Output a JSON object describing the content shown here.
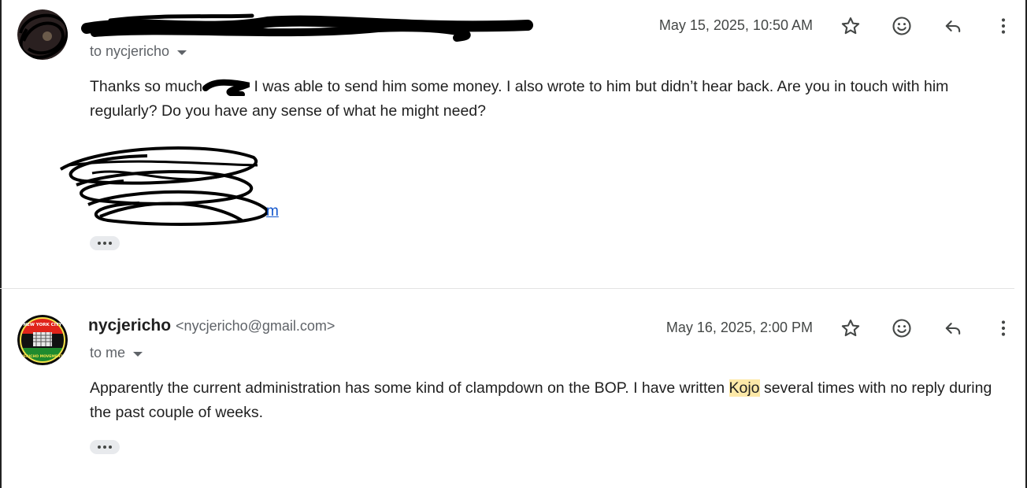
{
  "message1": {
    "to_label": "to nycjericho",
    "date": "May 15, 2025, 10:50 AM",
    "body_part1": "Thanks so much",
    "body_part2": "I was able to send him some money. I also wrote to him but didn’t hear back. Are you in touch with him regularly? Do you have any sense of what he might need?",
    "signature_link_tail": "m",
    "actions": [
      "star-icon",
      "emoji-icon",
      "reply-icon",
      "more-vert-icon"
    ]
  },
  "message2": {
    "sender_name": "nycjericho",
    "sender_email": "<nycjericho@gmail.com>",
    "to_label": "to me",
    "date": "May 16, 2025, 2:00 PM",
    "body_before": "Apparently the current administration has some kind of clampdown on the BOP. I have written ",
    "body_highlight": "Kojo",
    "body_after": " several times with no reply during the past couple of weeks.",
    "avatar_text_top": "NEW YORK CITY",
    "avatar_text_bottom": "JERICHO MOVEMENT",
    "actions": [
      "star-icon",
      "emoji-icon",
      "reply-icon",
      "more-vert-icon"
    ]
  },
  "colors": {
    "highlight": "#fde9a8",
    "link": "#1155cc",
    "secondary_text": "#5f6368"
  }
}
